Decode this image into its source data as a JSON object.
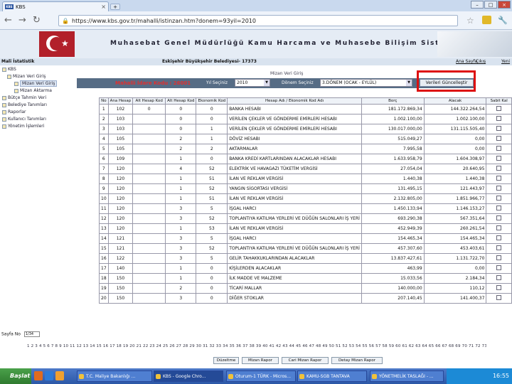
{
  "browser": {
    "tab_title": "KBS",
    "tab_favicon": "KBS",
    "url": "https://www.kbs.gov.tr/mahalli/istinzan.htm?donem=93yil=2010"
  },
  "header": {
    "title": "Muhasebat Genel Müdürlüğü Kamu Harcama ve Muhasebe Bilişim Sistemi",
    "left_label": "Mali İstatistik",
    "center_label": "Eskişehir Büyükşehir Belediyesi- 17373",
    "links": [
      "Ana Sayfa",
      "Çıkış",
      "Yeni"
    ]
  },
  "sidebar": {
    "root": "KBS",
    "items": [
      {
        "label": "Mizan Veri Giriş",
        "level": 1
      },
      {
        "label": "Mizan Veri Giriş",
        "level": 2,
        "selected": true
      },
      {
        "label": "Mizan Aktarma",
        "level": 2
      },
      {
        "label": "Bütçe Tahmin Veri",
        "level": 1
      },
      {
        "label": "Belediye Tanımları",
        "level": 1
      },
      {
        "label": "Raporlar",
        "level": 1
      },
      {
        "label": "Kullanıcı Tanımları",
        "level": 1
      },
      {
        "label": "Yönetim İşlemleri",
        "level": 1
      }
    ]
  },
  "section_title": "Mizan Veri Giriş",
  "toolbar": {
    "red_label": "Mahalli İdare Kodu : 26001",
    "year_label": "Yıl Seçiniz",
    "year_value": "2010",
    "period_label": "Dönem Seçiniz",
    "period_value": "3.DÖNEM (OCAK - EYLÜL)",
    "save_button": "Verileri Güncelleştir"
  },
  "table": {
    "columns": [
      "No",
      "Ana Hesap",
      "Alt Hesap Kod",
      "Alt Hesap Kod",
      "Ekonomik Kod",
      "Hesap Adı / Ekonomik Kod Adı",
      "Borç",
      "Alacak",
      "Sabit Kal"
    ],
    "rows": [
      [
        "1",
        "102",
        "0",
        "0",
        "0",
        "BANKA HESABI",
        "181.172.869,34",
        "144.322.264,54"
      ],
      [
        "2",
        "103",
        "",
        "0",
        "0",
        "VERİLEN ÇEKLER VE GÖNDERME EMİRLERİ HESABI",
        "1.002.100,00",
        "1.002.100,00"
      ],
      [
        "3",
        "103",
        "",
        "0",
        "1",
        "VERİLEN ÇEKLER VE GÖNDERME EMİRLERİ HESABI",
        "130.017.000,00",
        "131.115.505,40"
      ],
      [
        "4",
        "105",
        "",
        "2",
        "1",
        "DÖVİZ HESABI",
        "515.049,27",
        "0,00"
      ],
      [
        "5",
        "105",
        "",
        "2",
        "2",
        "AKTARMALAR",
        "7.995,58",
        "0,00"
      ],
      [
        "6",
        "109",
        "",
        "1",
        "0",
        "BANKA KREDİ KARTLARINDAN ALACAKLAR HESABI",
        "1.633.958,79",
        "1.604.308,97"
      ],
      [
        "7",
        "120",
        "",
        "4",
        "52",
        "ELEKTRİK VE HAVAGAZI TÜKETİM VERGİSİ",
        "27.054,04",
        "20.640,95"
      ],
      [
        "8",
        "120",
        "",
        "1",
        "51",
        "İLAN VE REKLAM VERGİSİ",
        "1.440,38",
        "1.440,38"
      ],
      [
        "9",
        "120",
        "",
        "1",
        "52",
        "YANGIN SİGORTASI VERGİSİ",
        "131.495,15",
        "121.443,97"
      ],
      [
        "10",
        "120",
        "",
        "1",
        "51",
        "İLAN VE REKLAM VERGİSİ",
        "2.132.805,00",
        "1.851.966,77"
      ],
      [
        "11",
        "120",
        "",
        "3",
        "5",
        "İŞGAL HARCI",
        "1.450.133,94",
        "1.146.153,27"
      ],
      [
        "12",
        "120",
        "",
        "3",
        "52",
        "TOPLANTIYA KATILMA YERLERİ VE DÜĞÜN SALONLARI İŞ YERİ",
        "693.290,38",
        "567.351,64"
      ],
      [
        "13",
        "120",
        "",
        "1",
        "53",
        "İLAN VE REKLAM VERGİSİ",
        "452.949,39",
        "260.261,54"
      ],
      [
        "14",
        "121",
        "",
        "3",
        "5",
        "İŞGAL HARCI",
        "154.465,34",
        "154.465,34"
      ],
      [
        "15",
        "121",
        "",
        "3",
        "52",
        "TOPLANTIYA KATILMA YERLERİ VE DÜĞÜN SALONLARI İŞ YERİ",
        "457.307,60",
        "453.403,61"
      ],
      [
        "16",
        "122",
        "",
        "3",
        "5",
        "GELİR TAHAKKUKLARINDAN ALACAKLAR",
        "13.837.427,61",
        "1.131.722,70"
      ],
      [
        "17",
        "140",
        "",
        "1",
        "0",
        "KİŞİLERDEN ALACAKLAR",
        "463,99",
        "0,00"
      ],
      [
        "18",
        "150",
        "",
        "1",
        "0",
        "İLK MADDE VE MALZEME",
        "15.033,56",
        "2.184,34"
      ],
      [
        "19",
        "150",
        "",
        "2",
        "0",
        "TİCARİ MALLAR",
        "140.000,00",
        "110,12"
      ],
      [
        "20",
        "150",
        "",
        "3",
        "0",
        "DİĞER STOKLAR",
        "207.140,45",
        "141.400,37"
      ]
    ]
  },
  "footer": {
    "page_label": "Sayfa No",
    "page_value": "1/34",
    "page_numbers": "1 2 3 4 5 6 7 8 9 10 11 12 13 14 15 16 17 18 19 20 21 22 23 24 25 26 27 28 29 30 31 32 33 34 35 36 37 38 39 40 41 42 43 44 45 46 47 48 49 50 51 52 53 54 55 56 57 58 59 60 61 62 63 64 65 66 67 68 69 70 71 72 73 74",
    "buttons": [
      "Düzeltme",
      "Mizan Rapor",
      "Cari Mizan Rapor",
      "Detay Mizan Rapor"
    ]
  },
  "taskbar": {
    "start": "Başlat",
    "tasks": [
      "T.C. Maliye Bakanlığı ...",
      "KBS - Google Chro...",
      "Oturum-1 TÜRK - Micros...",
      "KAMU-SGB TANTAVA",
      "YÖNETMELİK TASLAĞI - ..."
    ],
    "clock": "16:55"
  },
  "colors": {
    "toolbar": "#566c85",
    "highlight_box": "#dd1010",
    "taskbar": "#2c58a7"
  }
}
